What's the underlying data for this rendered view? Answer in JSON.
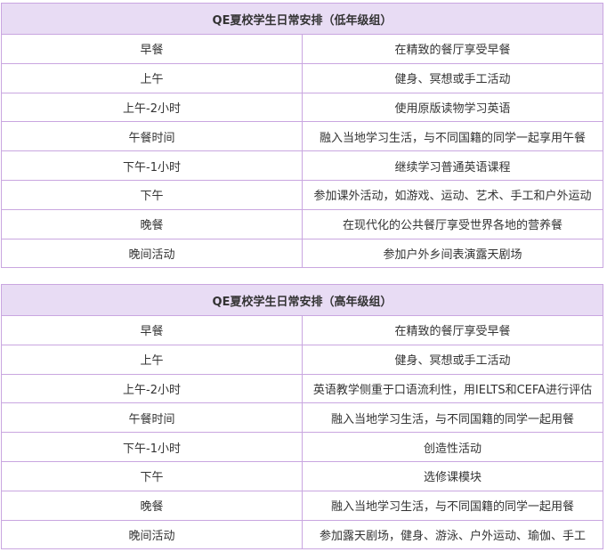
{
  "tables": [
    {
      "title": "QE夏校学生日常安排（低年级组）",
      "rows": [
        {
          "time": "早餐",
          "activity": "在精致的餐厅享受早餐"
        },
        {
          "time": "上午",
          "activity": "健身、冥想或手工活动"
        },
        {
          "time": "上午-2小时",
          "activity": "使用原版读物学习英语"
        },
        {
          "time": "午餐时间",
          "activity": "融入当地学习生活，与不同国籍的同学一起享用午餐"
        },
        {
          "time": "下午-1小时",
          "activity": "继续学习普通英语课程"
        },
        {
          "time": "下午",
          "activity": "参加课外活动，如游戏、运动、艺术、手工和户外运动"
        },
        {
          "time": "晚餐",
          "activity": "在现代化的公共餐厅享受世界各地的营养餐"
        },
        {
          "time": "晚间活动",
          "activity": "参加户外乡间表演露天剧场"
        }
      ]
    },
    {
      "title": "QE夏校学生日常安排（高年级组）",
      "rows": [
        {
          "time": "早餐",
          "activity": "在精致的餐厅享受早餐"
        },
        {
          "time": "上午",
          "activity": "健身、冥想或手工活动"
        },
        {
          "time": "上午-2小时",
          "activity": "英语教学侧重于口语流利性，用IELTS和CEFA进行评估"
        },
        {
          "time": "午餐时间",
          "activity": "融入当地学习生活，与不同国籍的同学一起用餐"
        },
        {
          "time": "下午-1小时",
          "activity": "创造性活动"
        },
        {
          "time": "下午",
          "activity": "选修课模块"
        },
        {
          "time": "晚餐",
          "activity": "融入当地学习生活，与不同国籍的同学一起用餐"
        },
        {
          "time": "晚间活动",
          "activity": "参加露天剧场，健身、游泳、户外运动、瑜伽、手工"
        }
      ]
    }
  ],
  "colors": {
    "header_bg": "#e8dcf4",
    "border": "#c9a6e0",
    "text": "#333333"
  }
}
